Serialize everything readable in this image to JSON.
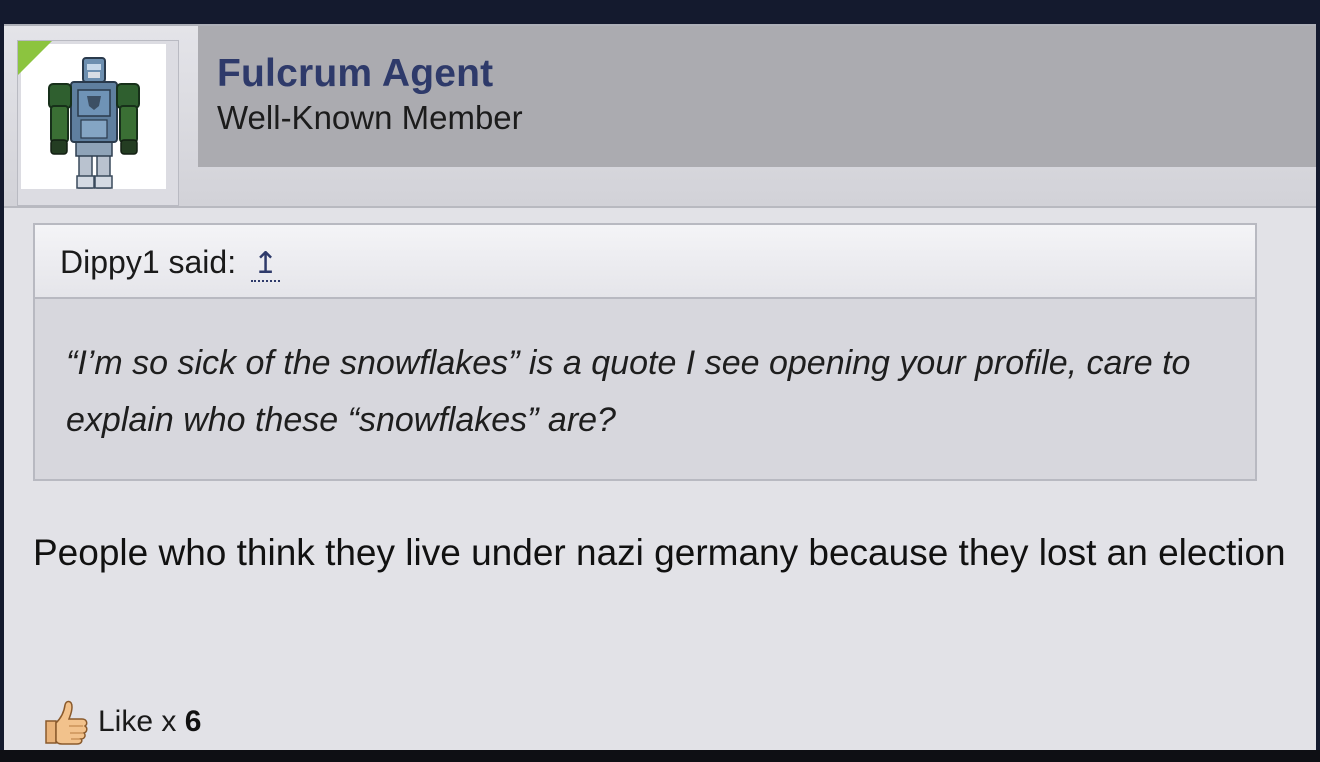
{
  "post": {
    "author": {
      "username": "Fulcrum Agent",
      "title": "Well-Known Member",
      "avatar": "robot-avatar-icon",
      "online_indicator_color": "#8cc43f"
    },
    "quote": {
      "author": "Dippy1",
      "said_label": "said:",
      "jump_icon": "↥",
      "text": "“I’m so sick of the snowflakes” is a quote I see opening your profile, care to explain who these “snowflakes” are?"
    },
    "message": "People who think they live under nazi germany because they lost an election",
    "likes": {
      "label": "Like x",
      "count": "6",
      "icon": "thumbs-up-icon"
    }
  },
  "colors": {
    "username": "#2e3a6a",
    "banner": "#ababb0",
    "post_background": "#e2e2e7",
    "quote_background": "#d7d7dd",
    "page_frame": "#141a2e"
  }
}
